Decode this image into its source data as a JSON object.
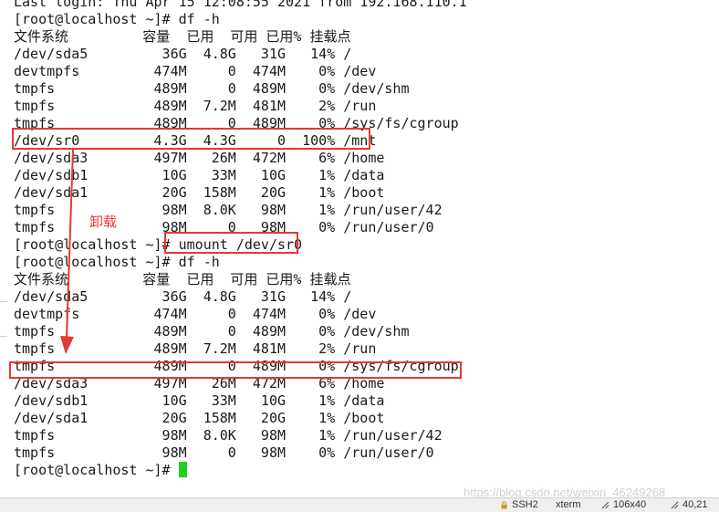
{
  "terminal": {
    "lines": [
      "Last login: Thu Apr 15 12:08:55 2021 from 192.168.110.1",
      "[root@localhost ~]# df -h",
      "文件系统         容量  已用  可用 已用% 挂载点",
      "/dev/sda5         36G  4.8G   31G   14% /",
      "devtmpfs         474M     0  474M    0% /dev",
      "tmpfs            489M     0  489M    0% /dev/shm",
      "tmpfs            489M  7.2M  481M    2% /run",
      "tmpfs            489M     0  489M    0% /sys/fs/cgroup",
      "/dev/sr0         4.3G  4.3G     0  100% /mnt",
      "/dev/sda3        497M   26M  472M    6% /home",
      "/dev/sdb1         10G   33M   10G    1% /data",
      "/dev/sda1         20G  158M   20G    1% /boot",
      "tmpfs             98M  8.0K   98M    1% /run/user/42",
      "tmpfs             98M     0   98M    0% /run/user/0",
      "[root@localhost ~]# umount /dev/sr0",
      "[root@localhost ~]# df -h",
      "文件系统         容量  已用  可用 已用% 挂载点",
      "/dev/sda5         36G  4.8G   31G   14% /",
      "devtmpfs         474M     0  474M    0% /dev",
      "tmpfs            489M     0  489M    0% /dev/shm",
      "tmpfs            489M  7.2M  481M    2% /run",
      "tmpfs            489M     0  489M    0% /sys/fs/cgroup",
      "/dev/sda3        497M   26M  472M    6% /home",
      "/dev/sdb1         10G   33M   10G    1% /data",
      "/dev/sda1         20G  158M   20G    1% /boot",
      "tmpfs             98M  8.0K   98M    1% /run/user/42",
      "tmpfs             98M     0   98M    0% /run/user/0"
    ],
    "prompt": "[root@localhost ~]# "
  },
  "annotation": {
    "label": "卸载",
    "color": "#e53935"
  },
  "watermark": "https://blog.csdn.net/weixin_46249268",
  "statusbar": {
    "ssh": "SSH2",
    "term": "xterm",
    "size": "106x40",
    "pos": "40,21"
  },
  "colors": {
    "cursor": "#1ed01e",
    "text": "#1a1a1a"
  }
}
